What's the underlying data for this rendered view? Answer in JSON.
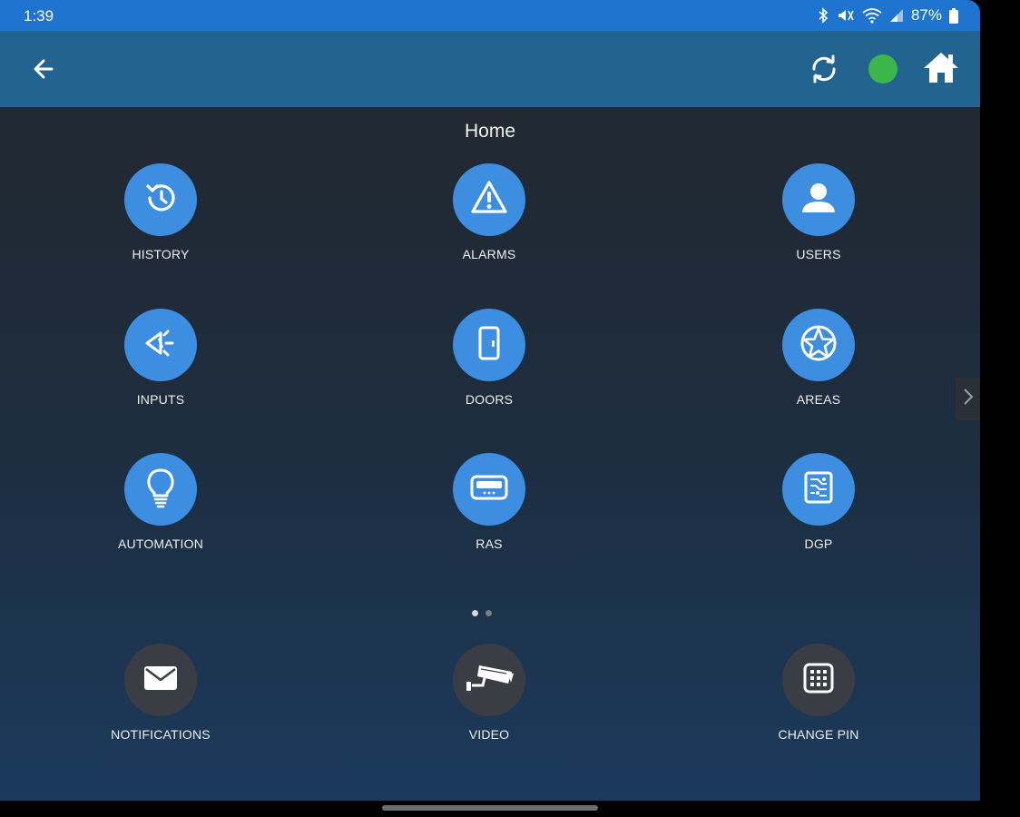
{
  "status_bar": {
    "time": "1:39",
    "battery": "87%"
  },
  "app_bar": {
    "back_icon": "arrow-left-icon",
    "sync_icon": "sync-icon",
    "status_color": "#3cb54a",
    "home_icon": "home-icon"
  },
  "page": {
    "title": "Home"
  },
  "tiles": [
    {
      "label": "HISTORY",
      "icon": "history-icon"
    },
    {
      "label": "ALARMS",
      "icon": "alarm-warning-icon"
    },
    {
      "label": "USERS",
      "icon": "user-icon"
    },
    {
      "label": "INPUTS",
      "icon": "inputs-icon"
    },
    {
      "label": "DOORS",
      "icon": "door-icon"
    },
    {
      "label": "AREAS",
      "icon": "area-star-icon"
    },
    {
      "label": "AUTOMATION",
      "icon": "lightbulb-icon"
    },
    {
      "label": "RAS",
      "icon": "keypad-device-icon"
    },
    {
      "label": "DGP",
      "icon": "circuit-board-icon"
    }
  ],
  "pager": {
    "pages": 2,
    "active": 1
  },
  "bottom_tiles": [
    {
      "label": "NOTIFICATIONS",
      "icon": "envelope-icon"
    },
    {
      "label": "VIDEO",
      "icon": "cctv-camera-icon"
    },
    {
      "label": "CHANGE PIN",
      "icon": "keypad-icon"
    }
  ],
  "colors": {
    "accent": "#3d8ee0",
    "status_bar": "#1e74cf",
    "app_bar": "#22648f",
    "online": "#3cb54a"
  }
}
